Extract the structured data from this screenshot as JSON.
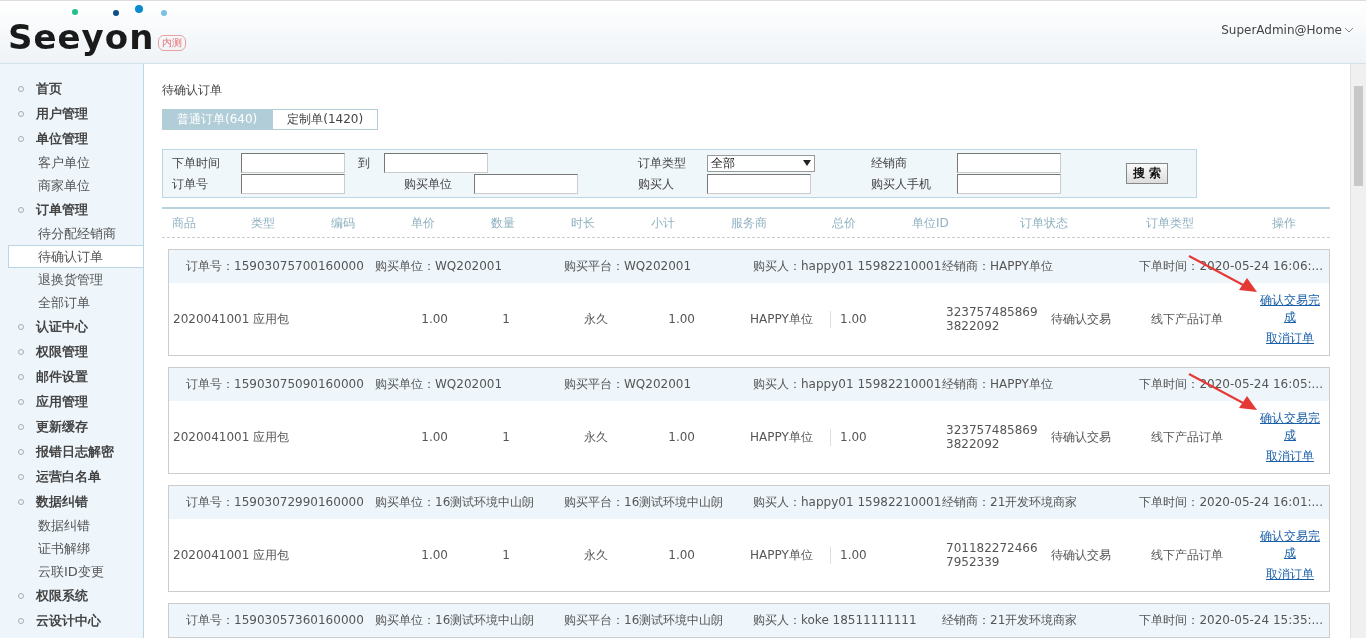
{
  "header": {
    "logo_text": "Seeyon",
    "logo_badge": "内测",
    "user": "SuperAdmin@Home"
  },
  "sidebar": {
    "items": [
      {
        "label": "首页",
        "selected": false
      },
      {
        "label": "用户管理",
        "selected": false
      },
      {
        "label": "单位管理",
        "selected": false,
        "children": [
          {
            "label": "客户单位",
            "selected": false
          },
          {
            "label": "商家单位",
            "selected": false
          }
        ]
      },
      {
        "label": "订单管理",
        "selected": false,
        "children": [
          {
            "label": "待分配经销商",
            "selected": false
          },
          {
            "label": "待确认订单",
            "selected": true
          },
          {
            "label": "退换货管理",
            "selected": false
          },
          {
            "label": "全部订单",
            "selected": false
          }
        ]
      },
      {
        "label": "认证中心",
        "selected": false
      },
      {
        "label": "权限管理",
        "selected": false
      },
      {
        "label": "邮件设置",
        "selected": false
      },
      {
        "label": "应用管理",
        "selected": false
      },
      {
        "label": "更新缓存",
        "selected": false
      },
      {
        "label": "报错日志解密",
        "selected": false
      },
      {
        "label": "运营白名单",
        "selected": false
      },
      {
        "label": "数据纠错",
        "selected": false,
        "children": [
          {
            "label": "数据纠错",
            "selected": false
          },
          {
            "label": "证书解绑",
            "selected": false
          },
          {
            "label": "云联ID变更",
            "selected": false
          }
        ]
      },
      {
        "label": "权限系统",
        "selected": false
      },
      {
        "label": "云设计中心",
        "selected": false
      }
    ]
  },
  "page_title": "待确认订单",
  "tabs": [
    {
      "label": "普通订单(640)",
      "selected": true
    },
    {
      "label": "定制单(1420)",
      "selected": false
    }
  ],
  "search": {
    "order_time_label": "下单时间",
    "to_label": "到",
    "order_no_label": "订单号",
    "buyer_unit_label": "购买单位",
    "order_type_label": "订单类型",
    "order_type_value": "全部",
    "buyer_label": "购买人",
    "dealer_label": "经销商",
    "buyer_phone_label": "购买人手机",
    "button": "搜 索"
  },
  "table": {
    "columns": [
      "商品",
      "类型",
      "编码",
      "单价",
      "数量",
      "时长",
      "小计",
      "服务商",
      "总价",
      "单位ID",
      "订单状态",
      "订单类型",
      "操作"
    ]
  },
  "orders": [
    {
      "order_no": "订单号：15903075700160000",
      "buyer_unit": "购买单位：WQ202001",
      "platform": "购买平台：WQ202001",
      "buyer": "购买人：happy01 15982210001",
      "dealer": "经销商：HAPPY单位",
      "time": "下单时间：2020-05-24 16:06:...",
      "annotated": true,
      "item": {
        "product": "2020041001 应用包",
        "price": "1.00",
        "qty": "1",
        "duration": "永久",
        "subtotal": "1.00",
        "provider": "HAPPY单位",
        "total": "1.00",
        "unit_id": "3237574858693822092",
        "status": "待确认交易",
        "order_type": "线下产品订单",
        "actions": [
          "确认交易完成",
          "取消订单"
        ]
      }
    },
    {
      "order_no": "订单号：15903075090160000",
      "buyer_unit": "购买单位：WQ202001",
      "platform": "购买平台：WQ202001",
      "buyer": "购买人：happy01 15982210001",
      "dealer": "经销商：HAPPY单位",
      "time": "下单时间：2020-05-24 16:05:...",
      "annotated": true,
      "item": {
        "product": "2020041001 应用包",
        "price": "1.00",
        "qty": "1",
        "duration": "永久",
        "subtotal": "1.00",
        "provider": "HAPPY单位",
        "total": "1.00",
        "unit_id": "3237574858693822092",
        "status": "待确认交易",
        "order_type": "线下产品订单",
        "actions": [
          "确认交易完成",
          "取消订单"
        ]
      }
    },
    {
      "order_no": "订单号：15903072990160000",
      "buyer_unit": "购买单位：16测试环境中山朗",
      "platform": "购买平台：16测试环境中山朗",
      "buyer": "购买人：happy01 15982210001",
      "dealer": "经销商：21开发环境商家",
      "time": "下单时间：2020-05-24 16:01:...",
      "annotated": false,
      "item": {
        "product": "2020041001 应用包",
        "price": "1.00",
        "qty": "1",
        "duration": "永久",
        "subtotal": "1.00",
        "provider": "HAPPY单位",
        "total": "1.00",
        "unit_id": "7011822724667952339",
        "status": "待确认交易",
        "order_type": "线下产品订单",
        "actions": [
          "确认交易完成",
          "取消订单"
        ]
      }
    },
    {
      "order_no": "订单号：15903057360160000",
      "buyer_unit": "购买单位：16测试环境中山朗",
      "platform": "购买平台：16测试环境中山朗",
      "buyer": "购买人：koke 18511111111",
      "dealer": "经销商：21开发环境商家",
      "time": "下单时间：2020-05-24 15:35:...",
      "annotated": false
    }
  ]
}
